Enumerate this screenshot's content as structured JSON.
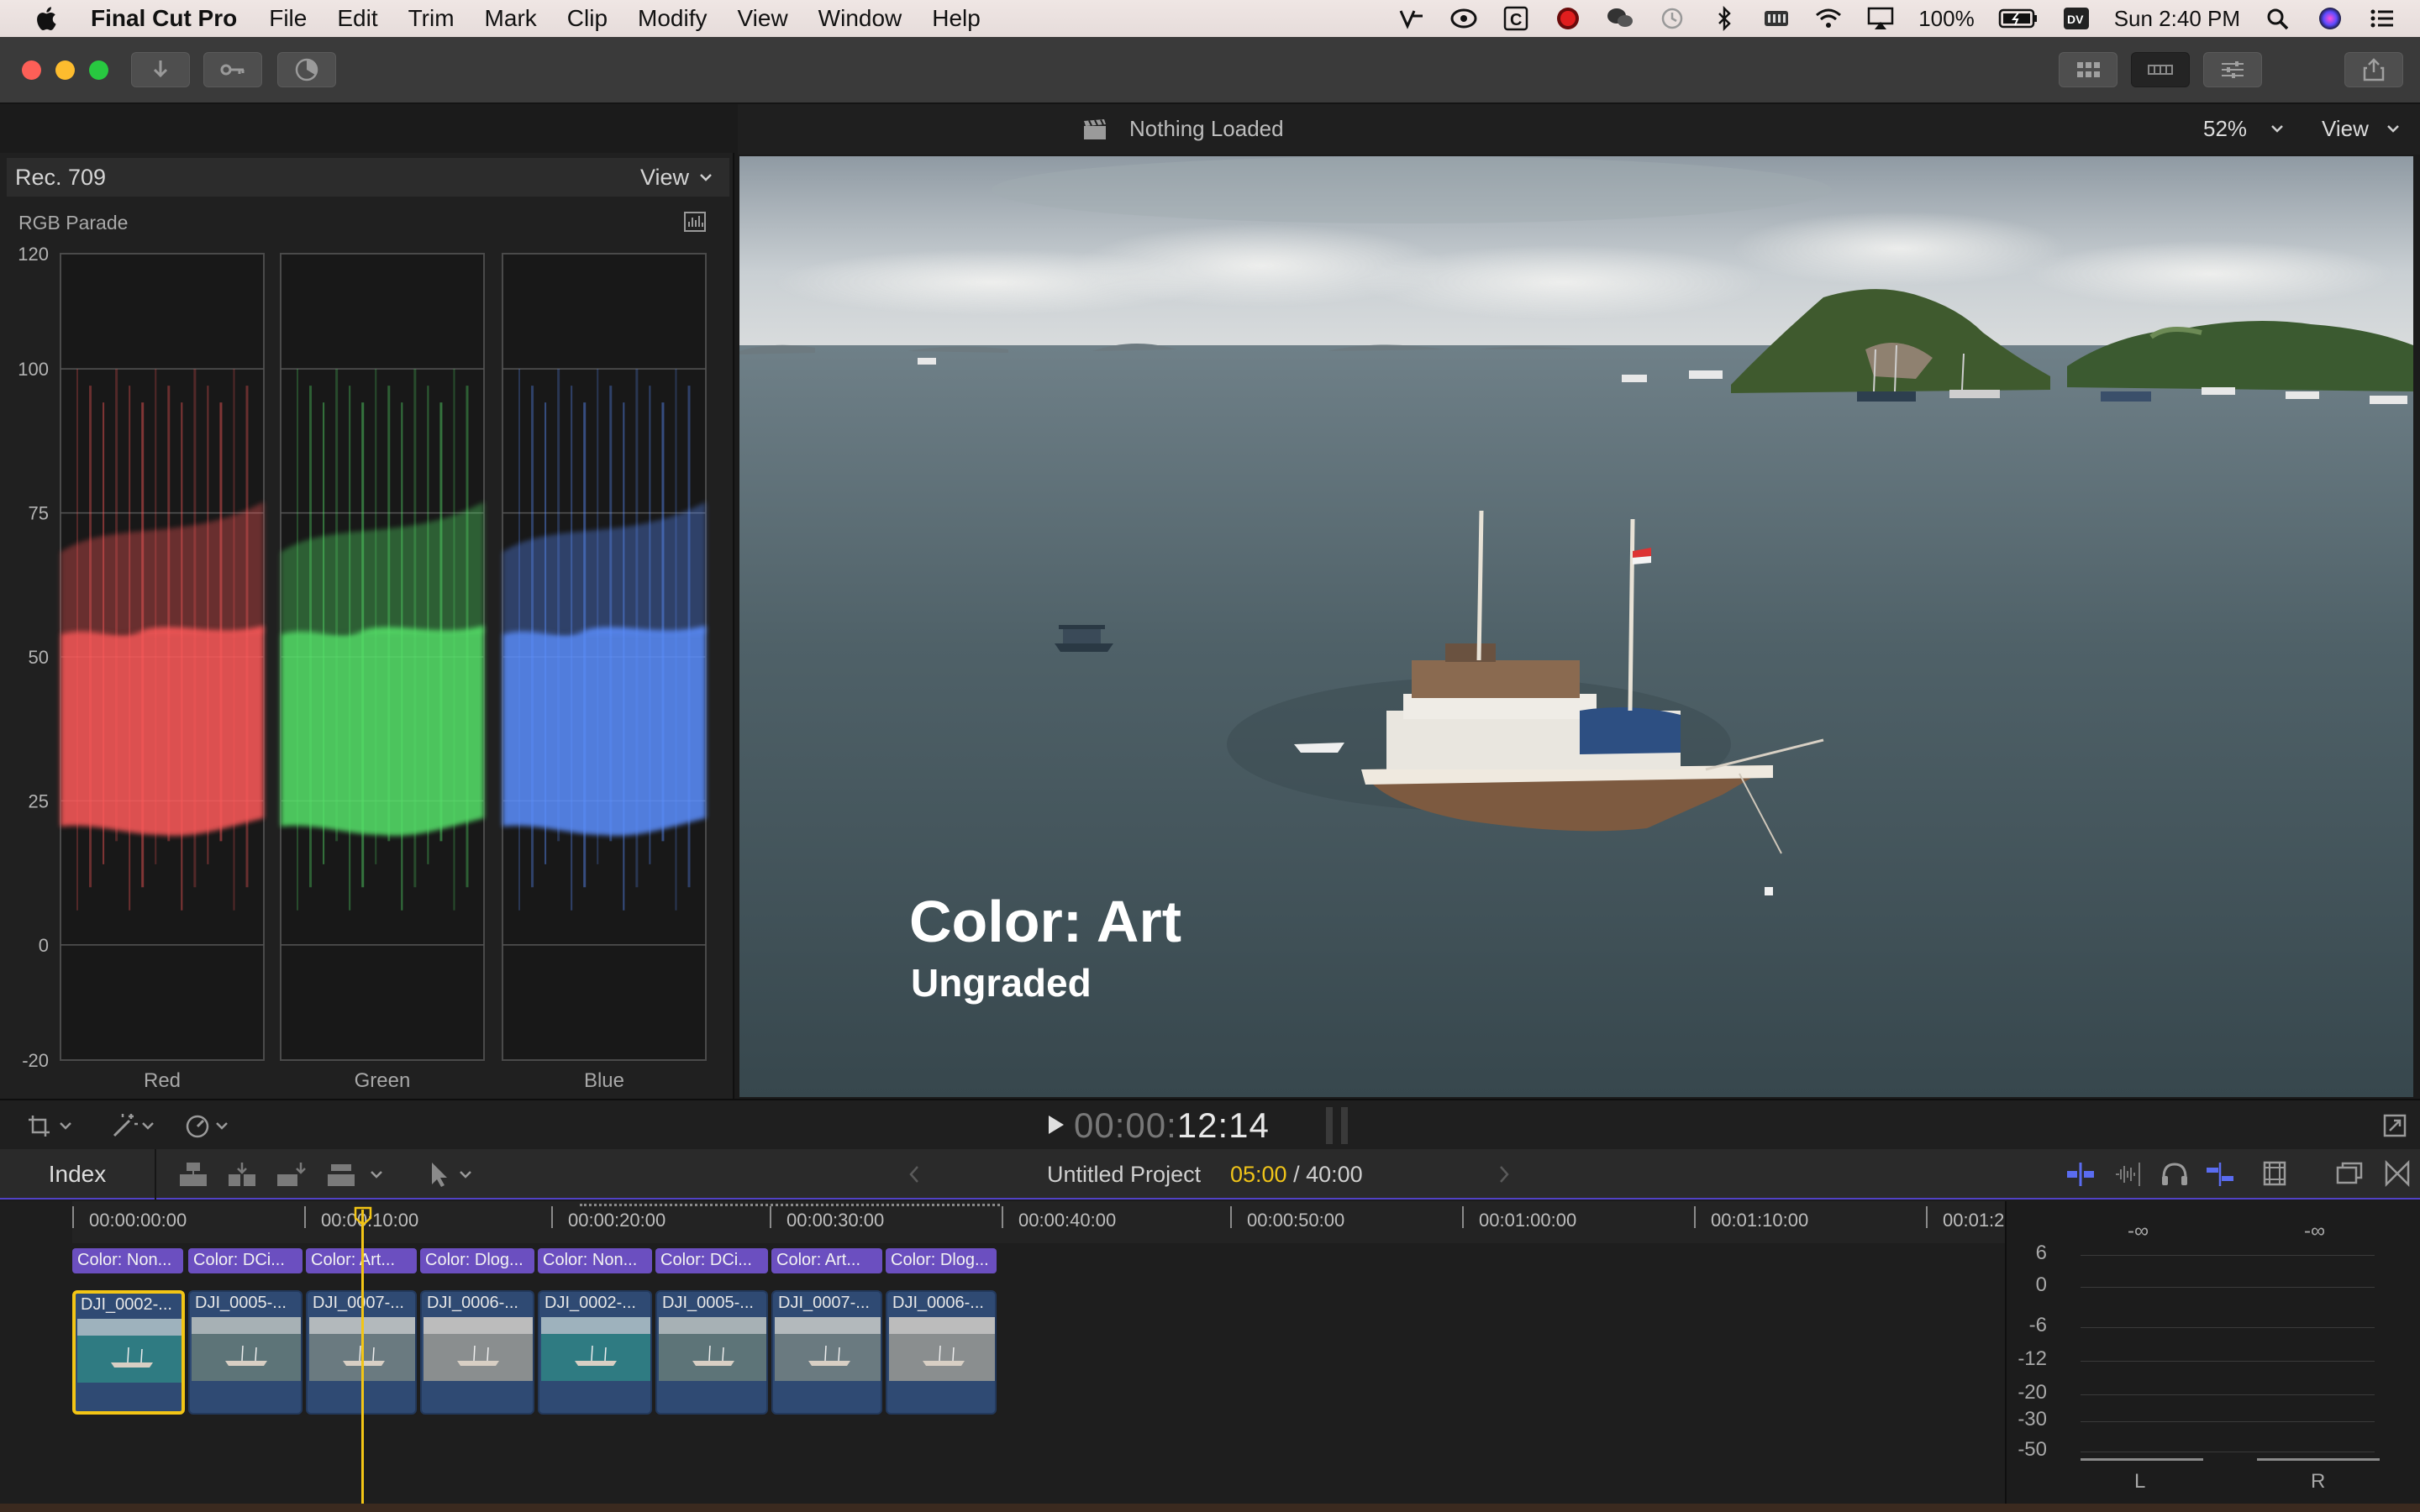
{
  "menubar": {
    "app_name": "Final Cut Pro",
    "menus": [
      "File",
      "Edit",
      "Trim",
      "Mark",
      "Clip",
      "Modify",
      "View",
      "Window",
      "Help"
    ],
    "battery": "100%",
    "clock": "Sun 2:40 PM"
  },
  "viewer": {
    "status": "Nothing Loaded",
    "zoom": "52%",
    "view_label": "View",
    "overlay_title": "Color: Art",
    "overlay_subtitle": "Ungraded"
  },
  "scopes": {
    "colorspace": "Rec. 709",
    "view_label": "View",
    "scope_type": "RGB Parade",
    "y_axis": [
      "120",
      "100",
      "75",
      "50",
      "25",
      "0",
      "-20"
    ],
    "channels": [
      {
        "label": "Red",
        "color": "#ff5a5a"
      },
      {
        "label": "Green",
        "color": "#56e36a"
      },
      {
        "label": "Blue",
        "color": "#5b8fff"
      }
    ]
  },
  "transport": {
    "timecode_dim": "00:00:",
    "timecode_bright": "12:14"
  },
  "timeline_header": {
    "index_label": "Index",
    "project_name": "Untitled Project",
    "current": "05:00",
    "separator": " / ",
    "total": "40:00"
  },
  "ruler": {
    "labels": [
      "00:00:00:00",
      "00:00:10:00",
      "00:00:20:00",
      "00:00:30:00",
      "00:00:40:00",
      "00:00:50:00",
      "00:01:00:00",
      "00:01:10:00",
      "00:01:2"
    ]
  },
  "roles": [
    "Color: Non...",
    "Color: DCi...",
    "Color: Art...",
    "Color: Dlog...",
    "Color: Non...",
    "Color: DCi...",
    "Color: Art...",
    "Color: Dlog..."
  ],
  "clips": [
    "DJI_0002-...",
    "DJI_0005-...",
    "DJI_0007-...",
    "DJI_0006-...",
    "DJI_0002-...",
    "DJI_0005-...",
    "DJI_0007-...",
    "DJI_0006-..."
  ],
  "audio_meter": {
    "peak_left": "-∞",
    "peak_right": "-∞",
    "scale": [
      "6",
      "0",
      "-6",
      "-12",
      "-20",
      "-30",
      "-50"
    ],
    "channels": [
      "L",
      "R"
    ]
  },
  "colors": {
    "accent_yellow": "#f3c515",
    "role_purple": "#6b4fc0",
    "clip_blue": "#2f4a73"
  }
}
